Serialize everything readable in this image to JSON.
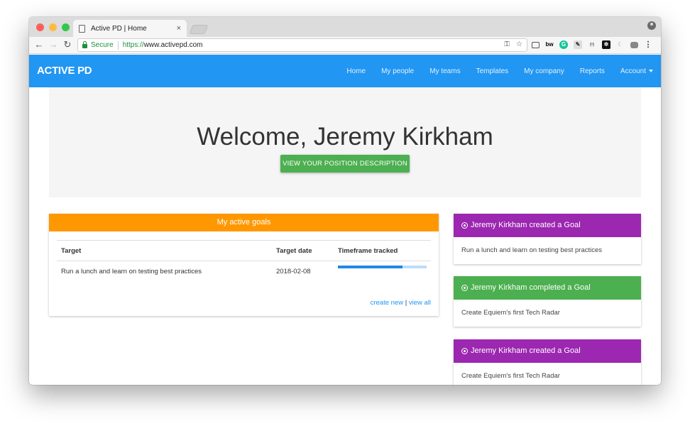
{
  "browser": {
    "tab_title": "Active PD | Home",
    "tab_close": "×",
    "secure_label": "Secure",
    "url_scheme": "https://",
    "url_rest": "www.activepd.com",
    "colors": {
      "close": "#fc605b",
      "minimize": "#fdbc40",
      "maximize": "#34c84a"
    }
  },
  "nav": {
    "brand": "ACTIVE PD",
    "links": [
      "Home",
      "My people",
      "My teams",
      "Templates",
      "My company",
      "Reports"
    ],
    "account_label": "Account",
    "color": "#2196f3"
  },
  "hero": {
    "welcome": "Welcome, Jeremy Kirkham",
    "button_label": "VIEW YOUR POSITION DESCRIPTION"
  },
  "goals": {
    "title": "My active goals",
    "headers": [
      "Target",
      "Target date",
      "Timeframe tracked"
    ],
    "rows": [
      {
        "target": "Run a lunch and learn on testing best practices",
        "date": "2018-02-08",
        "progress": 0.73
      }
    ],
    "create_label": "create new",
    "separator": "|",
    "view_label": "view all"
  },
  "feed": [
    {
      "title": "Jeremy Kirkham created a Goal",
      "body": "Run a lunch and learn on testing best practices",
      "color": "#9c27b0"
    },
    {
      "title": "Jeremy Kirkham completed a Goal",
      "body": "Create Equiem's first Tech Radar",
      "color": "#4caf50"
    },
    {
      "title": "Jeremy Kirkham created a Goal",
      "body": "Create Equiem's first Tech Radar",
      "color": "#9c27b0"
    }
  ]
}
